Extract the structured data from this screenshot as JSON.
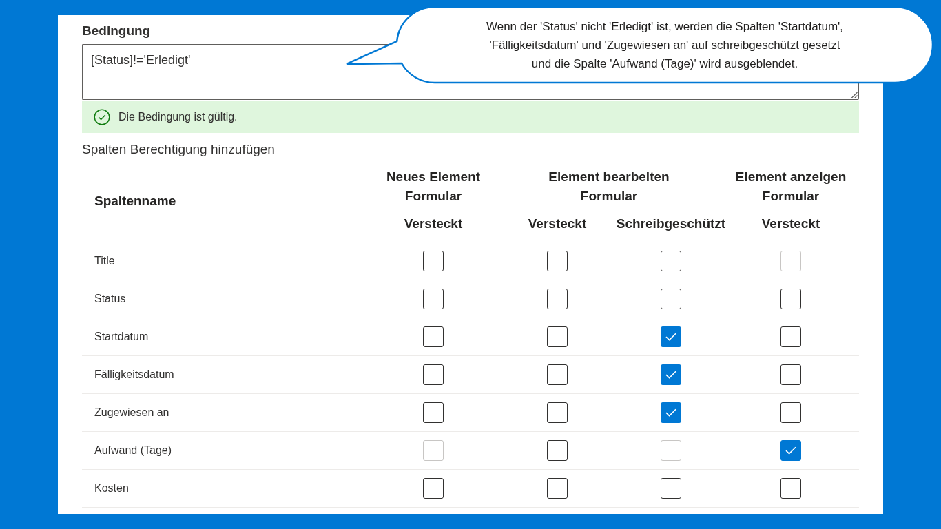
{
  "condition": {
    "label": "Bedingung",
    "value": "[Status]!='Erledigt'"
  },
  "validation": {
    "kind": "success",
    "message": "Die Bedingung ist gültig."
  },
  "callout": {
    "lines": [
      "Wenn der 'Status' nicht 'Erledigt' ist, werden die Spalten 'Startdatum',",
      "'Fälligkeitsdatum' und 'Zugewiesen an' auf schreibgeschützt gesetzt",
      "und die Spalte 'Aufwand (Tage)' wird ausgeblendet."
    ]
  },
  "permissions": {
    "title": "Spalten Berechtigung hinzufügen",
    "name_column": "Spaltenname",
    "groups": [
      {
        "label": "Neues Element Formular",
        "columns": [
          "Versteckt"
        ]
      },
      {
        "label": "Element bearbeiten Formular",
        "columns": [
          "Versteckt",
          "Schreibgeschützt"
        ]
      },
      {
        "label": "Element anzeigen Formular",
        "columns": [
          "Versteckt"
        ]
      }
    ],
    "rows": [
      {
        "name": "Title",
        "cells": [
          {
            "checked": false,
            "disabled": false
          },
          {
            "checked": false,
            "disabled": false
          },
          {
            "checked": false,
            "disabled": false
          },
          {
            "checked": false,
            "disabled": true
          }
        ]
      },
      {
        "name": "Status",
        "cells": [
          {
            "checked": false,
            "disabled": false
          },
          {
            "checked": false,
            "disabled": false
          },
          {
            "checked": false,
            "disabled": false
          },
          {
            "checked": false,
            "disabled": false
          }
        ]
      },
      {
        "name": "Startdatum",
        "cells": [
          {
            "checked": false,
            "disabled": false
          },
          {
            "checked": false,
            "disabled": false
          },
          {
            "checked": true,
            "disabled": false
          },
          {
            "checked": false,
            "disabled": false
          }
        ]
      },
      {
        "name": "Fälligkeitsdatum",
        "cells": [
          {
            "checked": false,
            "disabled": false
          },
          {
            "checked": false,
            "disabled": false
          },
          {
            "checked": true,
            "disabled": false
          },
          {
            "checked": false,
            "disabled": false
          }
        ]
      },
      {
        "name": "Zugewiesen an",
        "cells": [
          {
            "checked": false,
            "disabled": false
          },
          {
            "checked": false,
            "disabled": false
          },
          {
            "checked": true,
            "disabled": false
          },
          {
            "checked": false,
            "disabled": false
          }
        ]
      },
      {
        "name": "Aufwand (Tage)",
        "cells": [
          {
            "checked": false,
            "disabled": true
          },
          {
            "checked": false,
            "disabled": false
          },
          {
            "checked": false,
            "disabled": true
          },
          {
            "checked": true,
            "disabled": false
          }
        ]
      },
      {
        "name": "Kosten",
        "cells": [
          {
            "checked": false,
            "disabled": false
          },
          {
            "checked": false,
            "disabled": false
          },
          {
            "checked": false,
            "disabled": false
          },
          {
            "checked": false,
            "disabled": false
          }
        ]
      }
    ]
  }
}
